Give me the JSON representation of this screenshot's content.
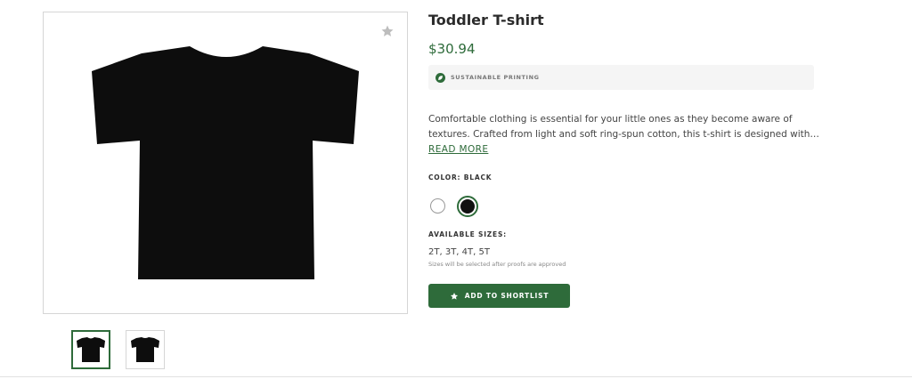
{
  "product": {
    "title": "Toddler T-shirt",
    "price": "$30.94",
    "badge": "SUSTAINABLE PRINTING",
    "description_line1": "Comfortable clothing is essential for your little ones as they become aware of",
    "description_line2": "textures. Crafted from light and soft ring-spun cotton, this t-shirt is designed with t...",
    "read_more": "READ MORE",
    "color_label": "COLOR: BLACK",
    "colors": [
      "white",
      "black"
    ],
    "selected_color": "black",
    "sizes_label": "AVAILABLE SIZES:",
    "sizes": "2T, 3T, 4T, 5T",
    "sizes_note": "Sizes will be selected after proofs are approved",
    "shortlist_label": "ADD TO SHORTLIST"
  },
  "theme": {
    "accent": "#2e6b3a",
    "swatch_white": "#ffffff",
    "swatch_black": "#111111"
  },
  "icons": {
    "favorite": "star-icon",
    "badge": "leaf-icon",
    "button": "star-icon"
  }
}
